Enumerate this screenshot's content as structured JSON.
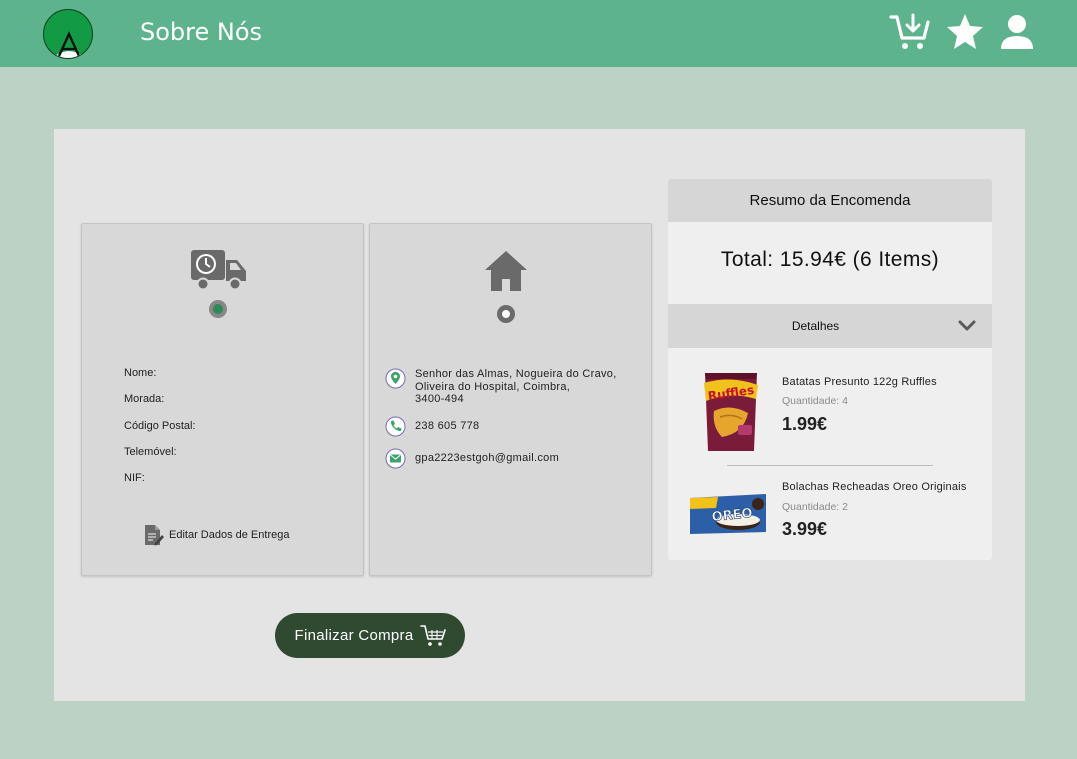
{
  "header": {
    "logo_letter": "A",
    "nav_about": "Sobre Nós",
    "icons": [
      "cart-download-icon",
      "star-icon",
      "user-icon"
    ],
    "bar_color": "#5db38c"
  },
  "delivery": {
    "icon": "truck-clock-icon",
    "selected": true,
    "fields": [
      "Nome:",
      "Morada:",
      "Código Postal:",
      "Telemóvel:",
      "NIF:"
    ],
    "edit_label": "Editar Dados de Entrega"
  },
  "store": {
    "icon": "house-icon",
    "selected": false,
    "address_line1": "Senhor das Almas, Nogueira do Cravo,",
    "address_line2": "Oliveira do Hospital, Coimbra,",
    "address_line3": "3400-494",
    "phone": "238 605 778",
    "email": "gpa2223estgoh@gmail.com"
  },
  "summary": {
    "title": "Resumo da Encomenda",
    "total": "Total: 15.94€ (6 Items)",
    "details_label": "Detalhes",
    "items": [
      {
        "name": "Batatas Presunto 122g Ruffles",
        "quantity": "Quantidade: 4",
        "price": "1.99€",
        "brand_text": "Ruffles"
      },
      {
        "name": "Bolachas Recheadas Oreo Originais",
        "quantity": "Quantidade: 2",
        "price": "3.99€",
        "brand_text": "OREO"
      }
    ]
  },
  "checkout": {
    "label": "Finalizar Compra",
    "color": "#2f4a30"
  }
}
